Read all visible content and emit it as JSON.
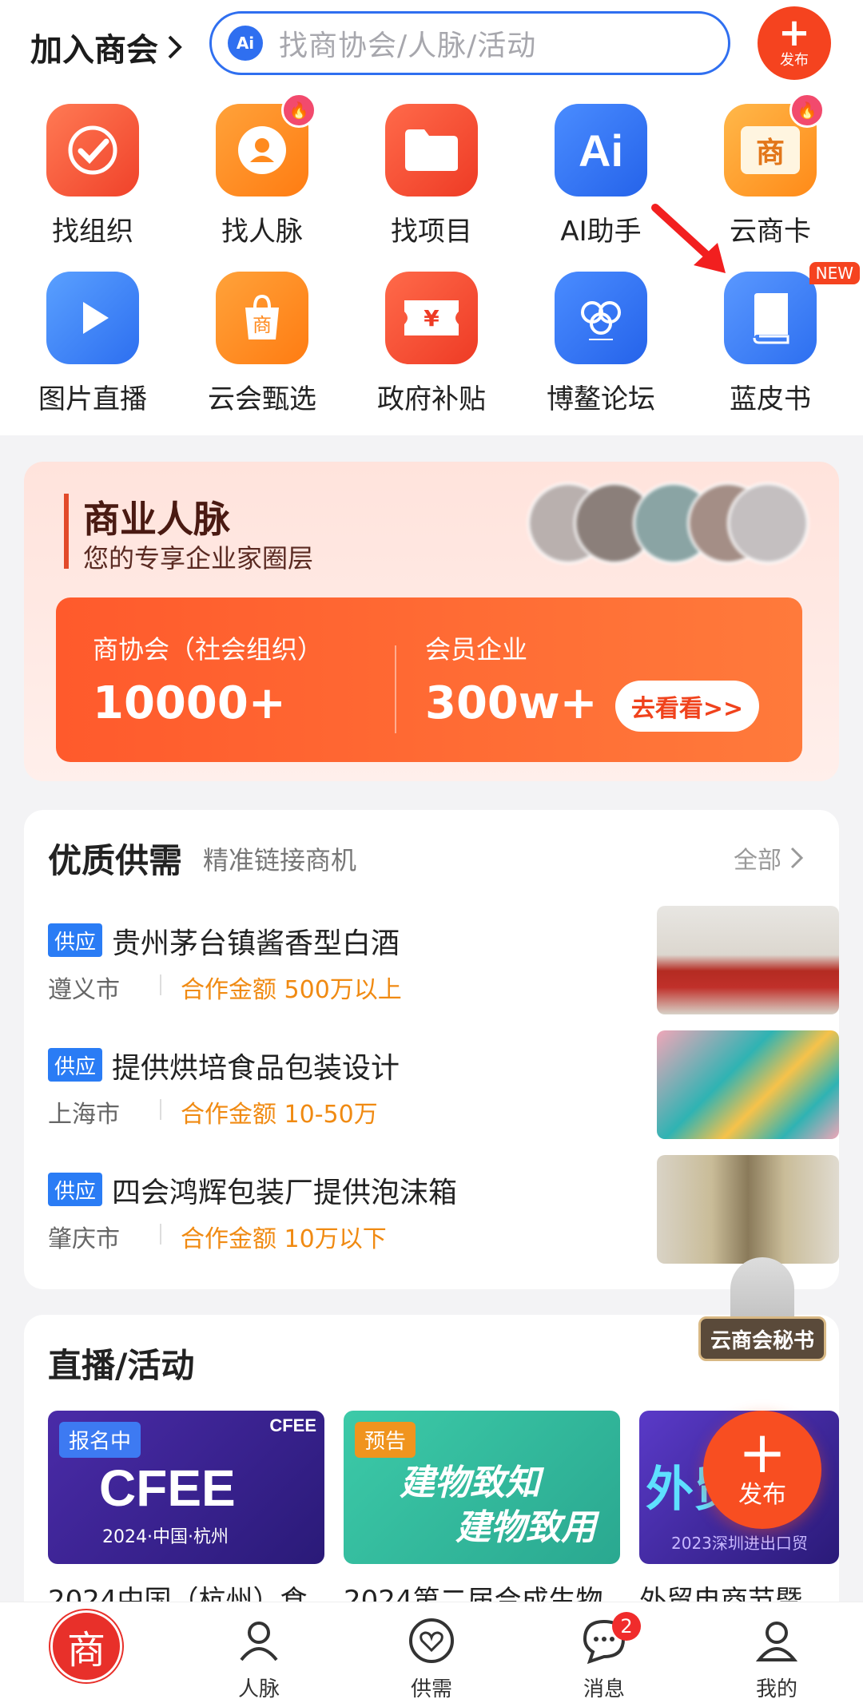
{
  "header": {
    "join_label": "加入商会",
    "search_ai_badge": "Ai",
    "search_placeholder": "找商协会/人脉/活动",
    "publish_label": "发布"
  },
  "shortcuts": [
    {
      "label": "找组织",
      "icon": "checkmark-circle-icon",
      "hot": false
    },
    {
      "label": "找人脉",
      "icon": "person-icon",
      "hot": true
    },
    {
      "label": "找项目",
      "icon": "folder-icon",
      "hot": false
    },
    {
      "label": "AI助手",
      "icon": "ai-icon",
      "hot": false
    },
    {
      "label": "云商卡",
      "icon": "shang-card-icon",
      "hot": true
    },
    {
      "label": "图片直播",
      "icon": "play-icon",
      "hot": false
    },
    {
      "label": "云会甄选",
      "icon": "shopping-bag-icon",
      "hot": false
    },
    {
      "label": "政府补贴",
      "icon": "yuan-ticket-icon",
      "hot": false
    },
    {
      "label": "博鳌论坛",
      "icon": "forum-logo-icon",
      "hot": false
    },
    {
      "label": "蓝皮书",
      "icon": "book-icon",
      "hot": false,
      "new": "NEW"
    }
  ],
  "biz": {
    "title": "商业人脉",
    "subtitle": "您的专享企业家圈层",
    "stat1_label": "商协会（社会组织）",
    "stat1_value": "10000+",
    "stat2_label": "会员企业",
    "stat2_value": "300w+",
    "button": "去看看>>"
  },
  "supply": {
    "title": "优质供需",
    "subtitle": "精准链接商机",
    "all": "全部",
    "items": [
      {
        "tag": "供应",
        "title": "贵州茅台镇酱香型白酒",
        "city": "遵义市",
        "amount": "合作金额 500万以上"
      },
      {
        "tag": "供应",
        "title": "提供烘培食品包装设计",
        "city": "上海市",
        "amount": "合作金额 10-50万"
      },
      {
        "tag": "供应",
        "title": "四会鸿辉包装厂提供泡沫箱",
        "city": "肇庆市",
        "amount": "合作金额 10万以下"
      }
    ]
  },
  "secretary": {
    "label": "云商会秘书"
  },
  "live": {
    "title": "直播/活动",
    "cards": [
      {
        "badge": "报名中",
        "name": "2024中国（杭州）食",
        "art_main": "CFEE",
        "art_sub": "2024·中国·杭州",
        "art_tag": "CFEE"
      },
      {
        "badge": "预告",
        "name": "2024第二届合成生物",
        "art_main": "建物致知",
        "art_sub": "建物致用"
      },
      {
        "badge": "",
        "name": "外贸电商节暨",
        "art_main": "外贸",
        "art_sub": "2023深圳进出口贸"
      }
    ]
  },
  "fab": {
    "label": "发布"
  },
  "tabbar": {
    "items": [
      {
        "label": "",
        "icon": "home-logo-icon"
      },
      {
        "label": "人脉",
        "icon": "people-icon"
      },
      {
        "label": "供需",
        "icon": "heart-exchange-icon"
      },
      {
        "label": "消息",
        "icon": "chat-icon",
        "badge": "2"
      },
      {
        "label": "我的",
        "icon": "profile-icon"
      }
    ]
  },
  "colors": {
    "accent": "#f5431f",
    "blue": "#2f6ff0",
    "amount": "#f08a12"
  }
}
